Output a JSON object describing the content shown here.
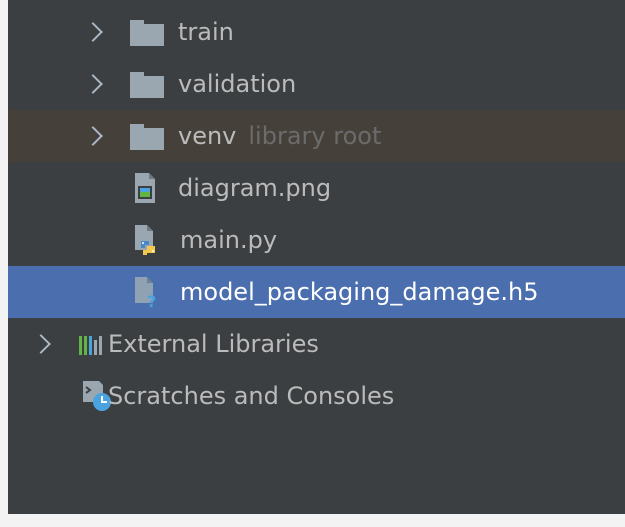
{
  "tree": {
    "items": [
      {
        "label": "train",
        "icon": "folder-icon"
      },
      {
        "label": "validation",
        "icon": "folder-icon"
      },
      {
        "label": "venv",
        "suffix": "library root",
        "icon": "folder-icon"
      },
      {
        "label": "diagram.png",
        "icon": "image-file-icon"
      },
      {
        "label": "main.py",
        "icon": "python-file-icon"
      },
      {
        "label": "model_packaging_damage.h5",
        "icon": "unknown-file-icon",
        "selected": true
      },
      {
        "label": "External Libraries",
        "icon": "libraries-icon"
      },
      {
        "label": "Scratches and Consoles",
        "icon": "scratches-icon"
      }
    ]
  },
  "colors": {
    "panel_bg": "#3c3f41",
    "selection_bg": "#4b6eaf",
    "excluded_bg": "#45413a",
    "text": "#bbbbbb",
    "dim_text": "#6b6b6b",
    "folder": "#9aa7b0"
  }
}
